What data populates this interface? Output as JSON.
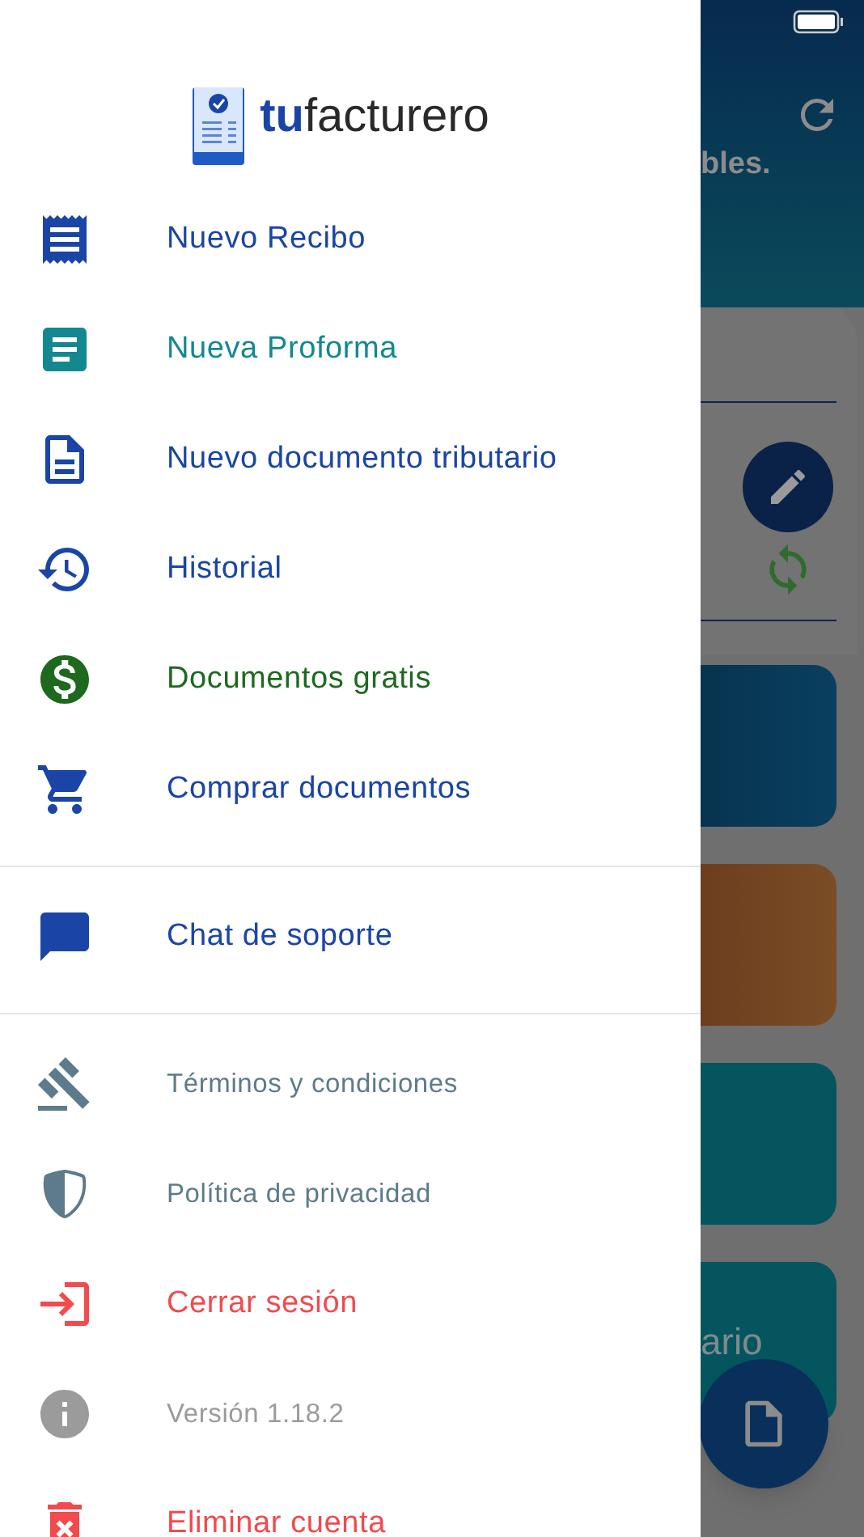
{
  "drawer": {
    "logo": "**tu**facturero",
    "sections": [
      {
        "items": [
          {
            "kind": "receipt",
            "label": "Nuevo Recibo",
            "color": "#1a45a6",
            "prominent": true
          },
          {
            "kind": "proforma",
            "label": "Nueva Proforma",
            "color": "#138891",
            "prominent": true
          },
          {
            "kind": "tax_document",
            "label": "Nuevo documento tributario",
            "color": "#1a45a6",
            "prominent": true
          },
          {
            "kind": "history",
            "label": "Historial",
            "color": "#1a45a6",
            "prominent": true
          },
          {
            "kind": "free",
            "label": "Documentos gratis",
            "color": "#1d6a1f",
            "prominent": true
          },
          {
            "kind": "cart",
            "label": "Comprar documentos",
            "color": "#1a45a6",
            "prominent": true
          }
        ]
      },
      {
        "items": [
          {
            "kind": "chat",
            "label": "Chat de soporte",
            "color": "#1a45a6",
            "prominent": true
          }
        ]
      },
      {
        "items": [
          {
            "kind": "terms",
            "label": "Términos y condiciones",
            "color": "#5d7b8a",
            "prominent": false
          },
          {
            "kind": "privacy",
            "label": "Política de privacidad",
            "color": "#5d7b8a",
            "prominent": false
          },
          {
            "kind": "logout",
            "label": "Cerrar sesión",
            "color": "#f24a4d",
            "prominent": true
          },
          {
            "kind": "info",
            "label": "Versión 1.18.2",
            "color": "#9b9b9b",
            "prominent": false
          },
          {
            "kind": "delete",
            "label": "Eliminar cuenta",
            "color": "#f24a4d",
            "prominent": true
          }
        ]
      }
    ]
  },
  "background_screen": {
    "heading_fragment": "bles.",
    "card_fragment": "ario"
  }
}
